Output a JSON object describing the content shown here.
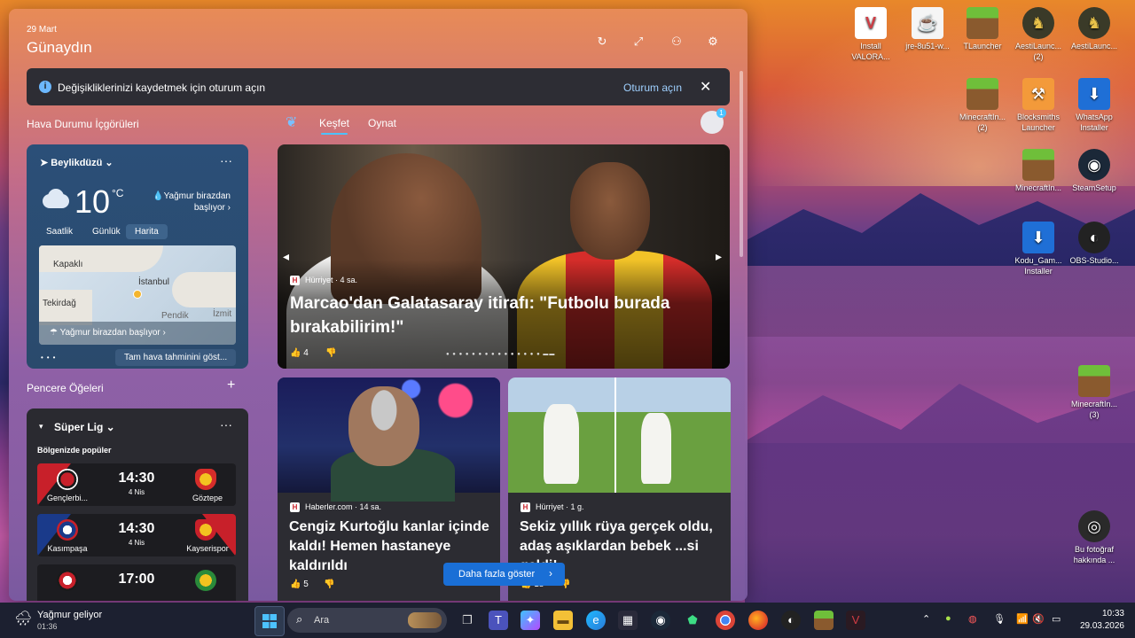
{
  "desktop": {
    "icons": [
      {
        "label": "Install VALORA...",
        "icon": "valorant-icon"
      },
      {
        "label": "jre-8u51-w...",
        "icon": "java-icon"
      },
      {
        "label": "TLauncher",
        "icon": "minecraft-icon"
      },
      {
        "label": "AestiLaunc... (2)",
        "icon": "viking-icon"
      },
      {
        "label": "AestiLaunc...",
        "icon": "viking-icon"
      },
      {
        "label": "MinecraftIn... (2)",
        "icon": "minecraft-icon"
      },
      {
        "label": "Blocksmiths Launcher",
        "icon": "hammer-icon"
      },
      {
        "label": "WhatsApp Installer",
        "icon": "download-icon"
      },
      {
        "label": "MinecraftIn...",
        "icon": "minecraft-icon"
      },
      {
        "label": "SteamSetup",
        "icon": "steam-icon"
      },
      {
        "label": "Kodu_Gam... Installer",
        "icon": "download-icon"
      },
      {
        "label": "OBS-Studio...",
        "icon": "obs-icon"
      },
      {
        "label": "MinecraftIn... (3)",
        "icon": "minecraft-icon"
      },
      {
        "label": "Bu fotoğraf hakkında ...",
        "icon": "camera-icon"
      }
    ]
  },
  "widgets": {
    "date": "29 Mart",
    "greeting": "Günaydın",
    "signin_bar": {
      "message": "Değişikliklerinizi kaydetmek için oturum açın",
      "action": "Oturum açın"
    },
    "weather_section_title": "Hava Durumu İçgörüleri",
    "tabs": [
      "Keşfet",
      "Oynat"
    ],
    "weather": {
      "location": "Beylikdüzü",
      "temperature": "10",
      "unit": "°C",
      "description": "Yağmur birazdan başlıyor",
      "tabs": [
        "Saatlik",
        "Günlük",
        "Harita"
      ],
      "map_labels": [
        "Kapaklı",
        "İstanbul",
        "Tekirdağ",
        "Pendik",
        "İzmit"
      ],
      "rain_notice": "Yağmur birazdan başlıyor",
      "forecast_button": "Tam hava tahminini göst..."
    },
    "widgets_section_title": "Pencere Öğeleri",
    "league": {
      "title": "Süper Lig",
      "subtitle": "Bölgenizde popüler",
      "matches": [
        {
          "home": "Gençlerbi...",
          "away": "Göztepe",
          "time": "14:30",
          "date": "4 Nis"
        },
        {
          "home": "Kasımpaşa",
          "away": "Kayserispor",
          "time": "14:30",
          "date": "4 Nis"
        },
        {
          "home": "",
          "away": "",
          "time": "17:00",
          "date": ""
        }
      ]
    },
    "hero": {
      "source": "Hürriyet",
      "age": "4 sa.",
      "headline": "Marcao'dan Galatasaray itirafı: \"Futbolu burada bırakabilirim!\"",
      "likes": "4"
    },
    "cards": [
      {
        "source": "Haberler.com",
        "age": "14 sa.",
        "headline": "Cengiz Kurtoğlu kanlar içinde kaldı! Hemen hastaneye kaldırıldı",
        "likes": "5"
      },
      {
        "source": "Hürriyet",
        "age": "1 g.",
        "headline": "Sekiz yıllık rüya gerçek oldu, adaş aşıklardan bebek ...si geldi!",
        "likes": "18"
      }
    ],
    "more_button": "Daha fazla göster"
  },
  "taskbar": {
    "weather": "Yağmur geliyor",
    "weather_time": "01:36",
    "search_placeholder": "Ara",
    "time": "10:33",
    "date": "29.03.2026"
  }
}
